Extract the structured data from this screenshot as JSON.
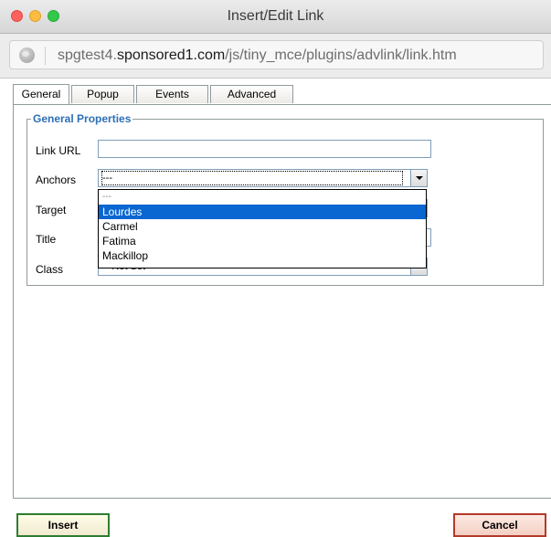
{
  "window": {
    "title": "Insert/Edit Link"
  },
  "url": {
    "prefix": "spgtest4.",
    "domain": "sponsored1.com",
    "path": "/js/tiny_mce/plugins/advlink/link.htm"
  },
  "tabs": [
    {
      "label": "General",
      "active": true
    },
    {
      "label": "Popup",
      "active": false
    },
    {
      "label": "Events",
      "active": false
    },
    {
      "label": "Advanced",
      "active": false
    }
  ],
  "general": {
    "legend": "General Properties",
    "link_url_label": "Link URL",
    "link_url_value": "",
    "anchors_label": "Anchors",
    "anchors_value": "---",
    "target_label": "Target",
    "title_label": "Title",
    "class_label": "Class",
    "class_value": "-- Not Set --"
  },
  "anchors_dropdown": {
    "options": [
      "---",
      "Lourdes",
      "Carmel",
      "Fatima",
      "Mackillop"
    ],
    "selected_index": 1
  },
  "buttons": {
    "insert": "Insert",
    "cancel": "Cancel"
  },
  "colors": {
    "legend": "#2b6fb6",
    "selection": "#0a66d0",
    "insert_border": "#2e7d32",
    "cancel_border": "#b33a2a"
  },
  "icons": [
    "globe-icon",
    "dropdown-arrow-icon"
  ]
}
